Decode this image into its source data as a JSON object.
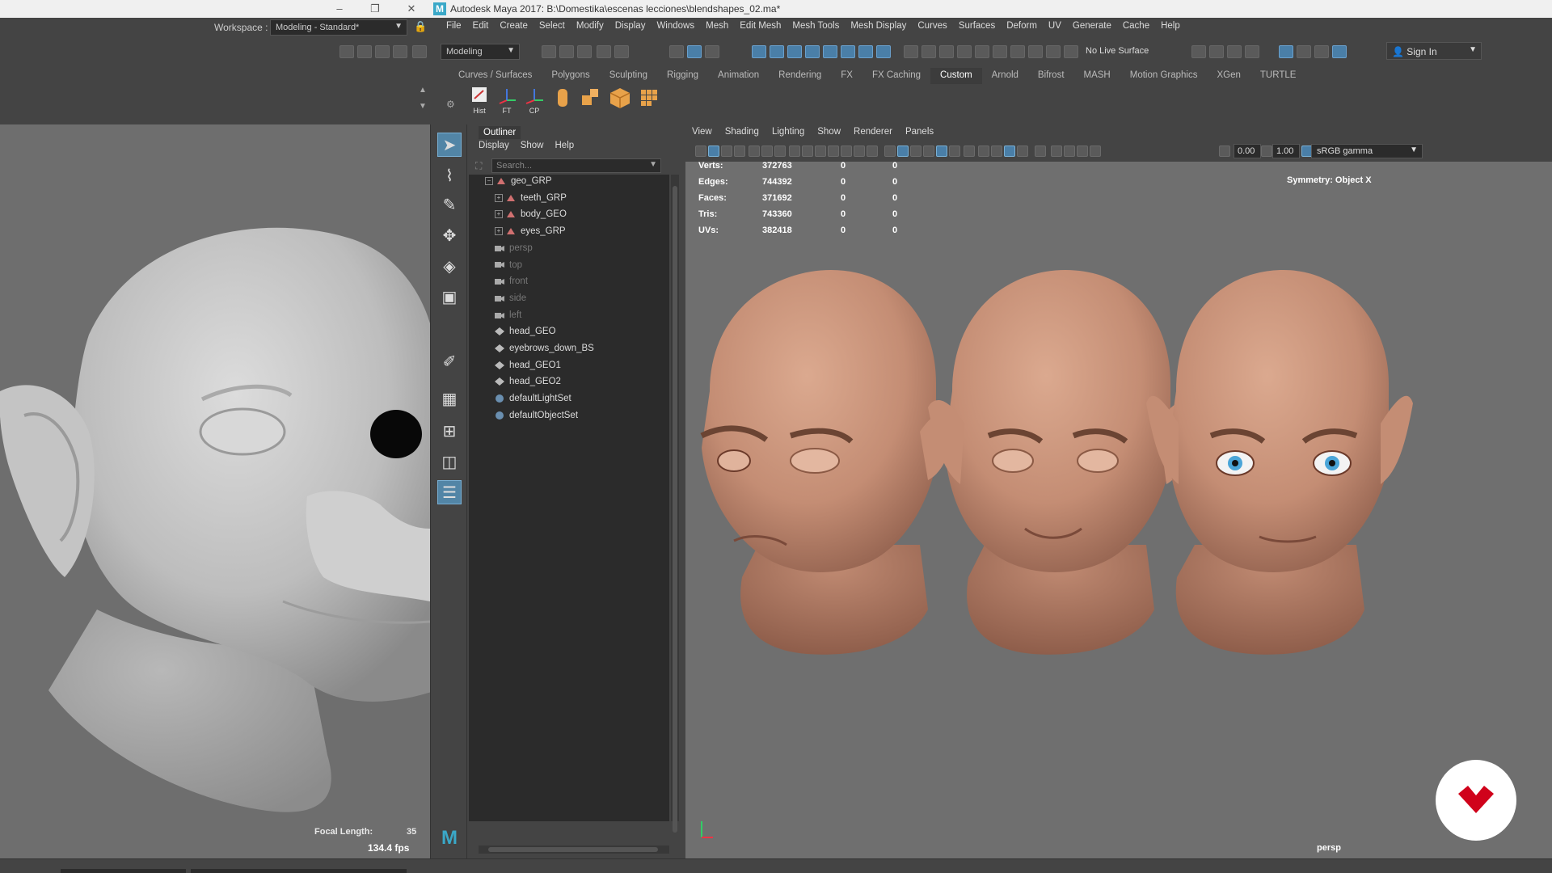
{
  "window": {
    "app_icon": "M",
    "title": "Autodesk Maya 2017: B:\\Domestika\\escenas lecciones\\blendshapes_02.ma*",
    "controls": [
      "–",
      "❐",
      "✕"
    ]
  },
  "workspace": {
    "label": "Workspace :",
    "value": "Modeling - Standard*"
  },
  "menus": [
    "File",
    "Edit",
    "Create",
    "Select",
    "Modify",
    "Display",
    "Windows",
    "Mesh",
    "Edit Mesh",
    "Mesh Tools",
    "Mesh Display",
    "Curves",
    "Surfaces",
    "Deform",
    "UV",
    "Generate",
    "Cache",
    "Help"
  ],
  "statusline": {
    "mode": "Modeling",
    "live_surface": "No Live Surface",
    "sign_in": "Sign In"
  },
  "shelf": {
    "tabs": [
      "Curves / Surfaces",
      "Polygons",
      "Sculpting",
      "Rigging",
      "Animation",
      "Rendering",
      "FX",
      "FX Caching",
      "Custom",
      "Arnold",
      "Bifrost",
      "MASH",
      "Motion Graphics",
      "XGen",
      "TURTLE"
    ],
    "active_tab": "Custom",
    "buttons": [
      {
        "label": "Hist",
        "icon": "history-icon"
      },
      {
        "label": "FT",
        "icon": "freeze-transform-icon"
      },
      {
        "label": "CP",
        "icon": "center-pivot-icon"
      }
    ]
  },
  "left_viewport": {
    "focal_label": "Focal Length:",
    "focal_value": "35",
    "fps": "134.4 fps"
  },
  "outliner": {
    "title": "Outliner",
    "menu": [
      "Display",
      "Show",
      "Help"
    ],
    "search_placeholder": "Search...",
    "items": [
      {
        "name": "geo_GRP",
        "type": "group",
        "level": 0,
        "expanded": true
      },
      {
        "name": "teeth_GRP",
        "type": "group",
        "level": 1
      },
      {
        "name": "body_GEO",
        "type": "group",
        "level": 1
      },
      {
        "name": "eyes_GRP",
        "type": "group",
        "level": 1
      },
      {
        "name": "persp",
        "type": "camera",
        "level": 0,
        "dim": true
      },
      {
        "name": "top",
        "type": "camera",
        "level": 0,
        "dim": true
      },
      {
        "name": "front",
        "type": "camera",
        "level": 0,
        "dim": true
      },
      {
        "name": "side",
        "type": "camera",
        "level": 0,
        "dim": true
      },
      {
        "name": "left",
        "type": "camera",
        "level": 0,
        "dim": true
      },
      {
        "name": "head_GEO",
        "type": "mesh",
        "level": 0
      },
      {
        "name": "eyebrows_down_BS",
        "type": "mesh",
        "level": 0
      },
      {
        "name": "head_GEO1",
        "type": "mesh",
        "level": 0
      },
      {
        "name": "head_GEO2",
        "type": "mesh",
        "level": 0
      },
      {
        "name": "defaultLightSet",
        "type": "set",
        "level": 0
      },
      {
        "name": "defaultObjectSet",
        "type": "set",
        "level": 0
      }
    ]
  },
  "viewport": {
    "menu": [
      "View",
      "Shading",
      "Lighting",
      "Show",
      "Renderer",
      "Panels"
    ],
    "exposure": "0.00",
    "gamma": "1.00",
    "color_space": "sRGB gamma",
    "stats": [
      {
        "label": "Verts:",
        "v1": "372763",
        "v2": "0",
        "v3": "0"
      },
      {
        "label": "Edges:",
        "v1": "744392",
        "v2": "0",
        "v3": "0"
      },
      {
        "label": "Faces:",
        "v1": "371692",
        "v2": "0",
        "v3": "0"
      },
      {
        "label": "Tris:",
        "v1": "743360",
        "v2": "0",
        "v3": "0"
      },
      {
        "label": "UVs:",
        "v1": "382418",
        "v2": "0",
        "v3": "0"
      }
    ],
    "symmetry": "Symmetry: Object X",
    "camera": "persp"
  },
  "colors": {
    "accent": "#5285a6",
    "skin": "#c9927b",
    "logo": "#d0021b"
  }
}
